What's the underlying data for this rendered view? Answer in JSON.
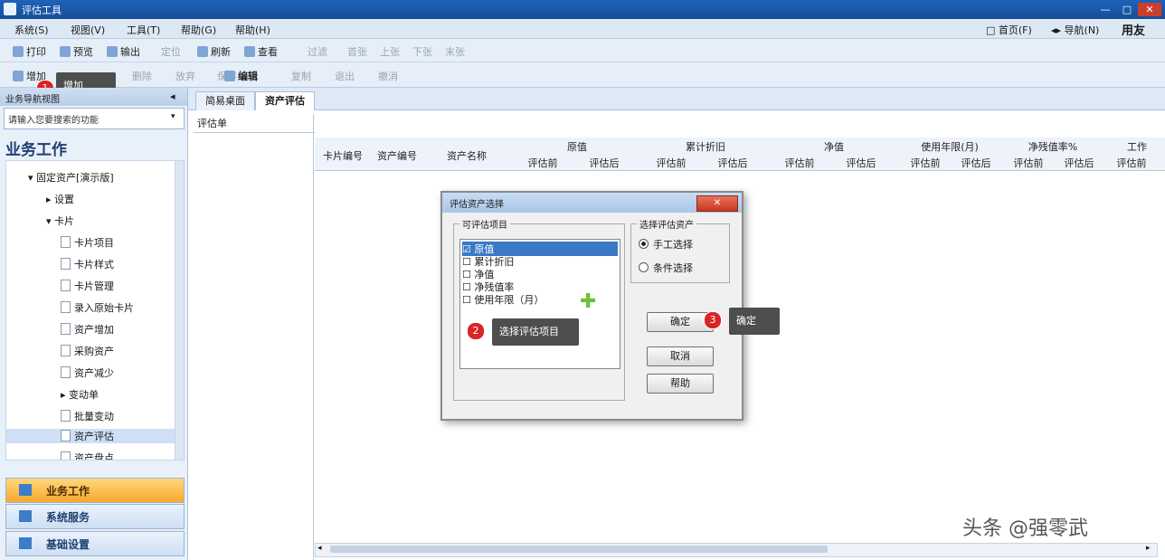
{
  "window": {
    "title": "评估工具",
    "min": "—",
    "max": "□",
    "close": "✕"
  },
  "menubar": {
    "items": [
      "系统(S)",
      "视图(V)",
      "工具(T)",
      "帮助(G)",
      "帮助(H)"
    ],
    "right": [
      "□ 首页(F)",
      "◂▸ 导航(N)"
    ],
    "brand": "用友"
  },
  "toolbar1": {
    "items": [
      "打印",
      "预览",
      "输出",
      "定位",
      "刷新",
      "查看",
      "过滤",
      "首张",
      "上张",
      "下张",
      "末张"
    ]
  },
  "toolbar2": {
    "items": [
      "增加",
      "删除",
      "放弃",
      "保存",
      "编辑",
      "复制",
      "退出",
      "撤消"
    ]
  },
  "callouts": {
    "c1": {
      "num": "1",
      "text": "增加"
    },
    "c2": {
      "num": "2",
      "text": "选择评估项目"
    },
    "c3": {
      "num": "3",
      "text": "确定"
    }
  },
  "left_panel": {
    "header": "业务导航视图",
    "combo": "请输入您要搜索的功能",
    "section": "业务工作",
    "tree": [
      "固定资产[演示版]",
      "设置",
      "卡片",
      "卡片项目",
      "卡片样式",
      "卡片管理",
      "录入原始卡片",
      "资产增加",
      "采购资产",
      "资产减少",
      "变动单",
      "批量变动",
      "资产评估",
      "资产盘点"
    ],
    "nav": [
      "业务工作",
      "系统服务",
      "基础设置"
    ]
  },
  "tabs": [
    "简易桌面",
    "资产评估"
  ],
  "sublist_header": "评估单",
  "grid": {
    "cols": [
      "卡片编号",
      "资产编号",
      "资产名称"
    ],
    "groups": [
      "原值",
      "累计折旧",
      "净值",
      "使用年限(月)",
      "净残值率%",
      "工作"
    ],
    "sub": [
      "评估前",
      "评估后"
    ]
  },
  "dialog": {
    "title": "评估资产选择",
    "left_group": "可评估项目",
    "items": [
      "原值",
      "累计折旧",
      "净值",
      "净残值率",
      "使用年限（月）"
    ],
    "checked": [
      true,
      false,
      false,
      false,
      false
    ],
    "right_group": "选择评估资产",
    "radio_manual": "手工选择",
    "radio_cond": "条件选择",
    "ok": "确定",
    "cancel": "取消",
    "help": "帮助"
  },
  "watermark": "头条 @强零武"
}
